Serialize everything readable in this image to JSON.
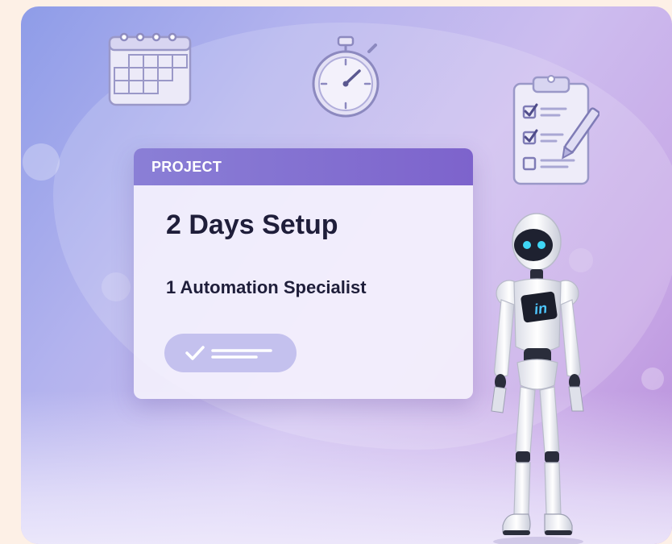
{
  "card": {
    "header": "PROJECT",
    "title": "2 Days Setup",
    "subtitle": "1 Automation Specialist"
  },
  "robot": {
    "chest_badge": "in"
  },
  "icons": [
    "calendar-icon",
    "stopwatch-icon",
    "clipboard-checklist-icon",
    "check-icon"
  ],
  "colors": {
    "header_start": "#8a7fd6",
    "header_end": "#7d63cc",
    "text_dark": "#1f1e3a",
    "robot_eye": "#3fd6f5",
    "badge_text": "#4dc6ff"
  }
}
